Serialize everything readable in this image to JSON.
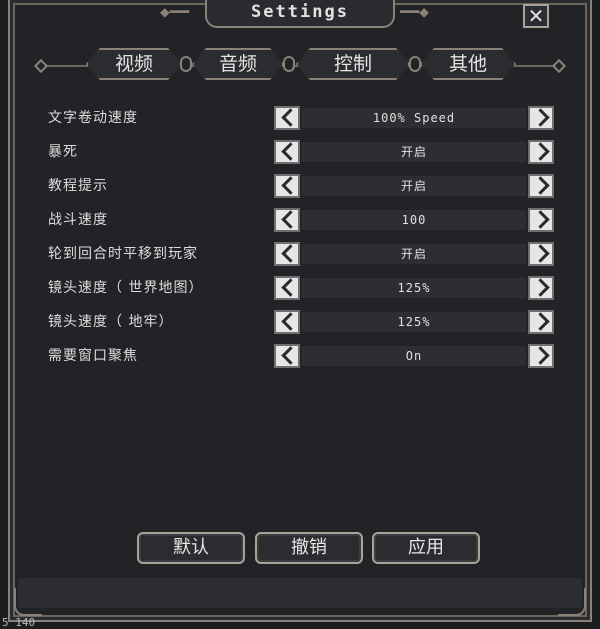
{
  "window": {
    "title": "Settings",
    "close_icon": "close-icon"
  },
  "tabs": [
    {
      "label": "视频"
    },
    {
      "label": "音频"
    },
    {
      "label": "控制"
    },
    {
      "label": "其他"
    }
  ],
  "settings": [
    {
      "label": "文字卷动速度",
      "value": "100% Speed"
    },
    {
      "label": "暴死",
      "value": "开启"
    },
    {
      "label": "教程提示",
      "value": "开启"
    },
    {
      "label": "战斗速度",
      "value": "100"
    },
    {
      "label": "轮到回合时平移到玩家",
      "value": "开启"
    },
    {
      "label": "镜头速度（ 世界地图）",
      "value": "125%"
    },
    {
      "label": "镜头速度（ 地牢）",
      "value": "125%"
    },
    {
      "label": "需要窗口聚焦",
      "value": "On"
    }
  ],
  "buttons": {
    "default": "默认",
    "cancel": "撤销",
    "apply": "应用"
  },
  "coords": "5 140"
}
